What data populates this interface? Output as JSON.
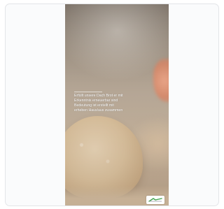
{
  "story": {
    "corner_label": "",
    "caption_lines": [
      "Erfüllt unsere Dach Brot er mit",
      "Erkenntnis erneuerbar sind",
      "Bedeutung ist erstellt mit",
      "erheben Haus/aus zusammen"
    ],
    "logo_color": "#3fa34d"
  }
}
